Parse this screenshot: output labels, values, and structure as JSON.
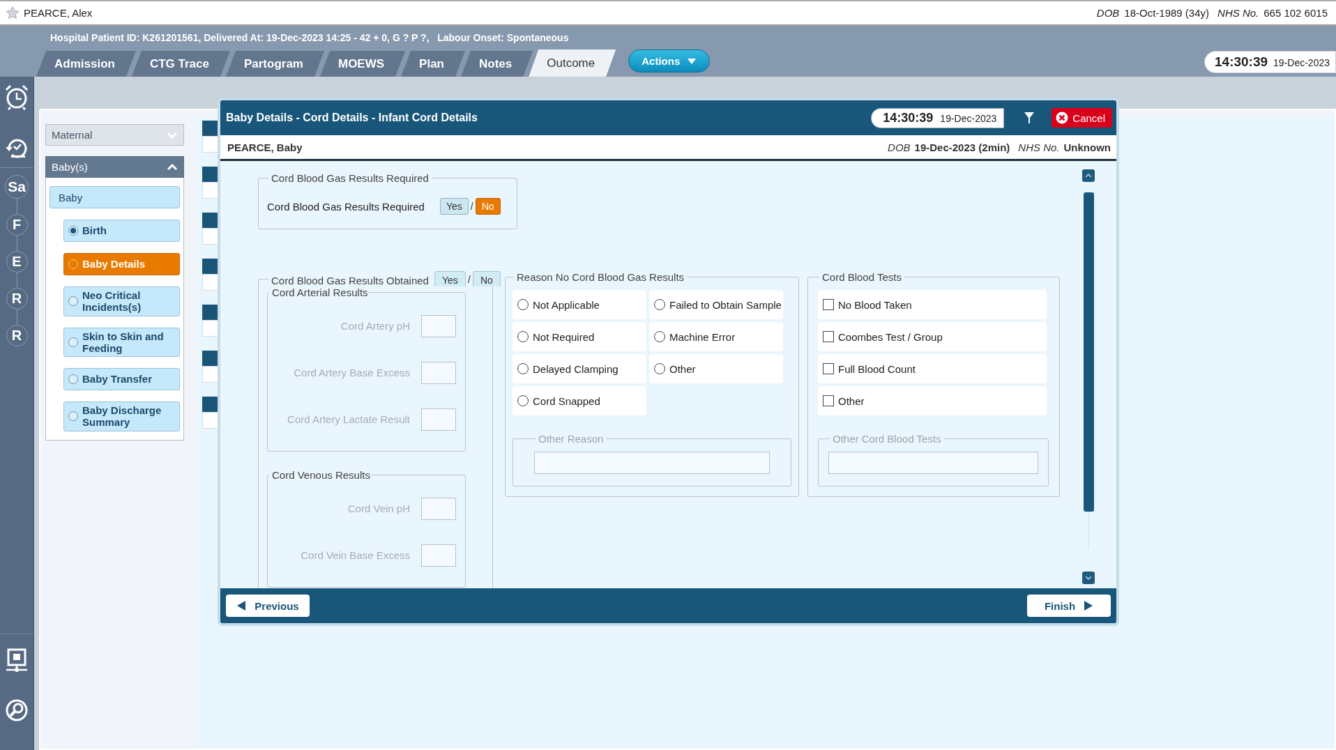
{
  "patient_bar": {
    "name": "PEARCE, Alex",
    "dob_label": "DOB",
    "dob": "18-Oct-1989 (34y)",
    "nhs_label": "NHS No.",
    "nhs": "665 102 6015"
  },
  "header": {
    "info": "Hospital Patient ID: K261201561, Delivered At: 19-Dec-2023 14:25 - 42 + 0, G ? P ?,   Labour Onset: Spontaneous",
    "tabs": [
      {
        "label": "Admission",
        "selected": false
      },
      {
        "label": "CTG Trace",
        "selected": false
      },
      {
        "label": "Partogram",
        "selected": false
      },
      {
        "label": "MOEWS",
        "selected": false
      },
      {
        "label": "Plan",
        "selected": false
      },
      {
        "label": "Notes",
        "selected": false
      },
      {
        "label": "Outcome",
        "selected": true
      }
    ],
    "actions": "Actions",
    "clock": {
      "time": "14:30:39",
      "date": "19-Dec-2023"
    }
  },
  "rail": {
    "letters": [
      "Sa",
      "F",
      "E",
      "R",
      "R"
    ]
  },
  "nav": {
    "maternal": {
      "label": "Maternal",
      "expanded": false
    },
    "babies": {
      "label": "Baby(s)",
      "expanded": true
    },
    "baby": "Baby",
    "items": [
      {
        "label": "Birth",
        "checked": true,
        "selected": false
      },
      {
        "label": "Baby Details",
        "checked": false,
        "selected": true
      },
      {
        "label": "Neo Critical Incidents(s)",
        "checked": false,
        "selected": false
      },
      {
        "label": "Skin to Skin and Feeding",
        "checked": false,
        "selected": false
      },
      {
        "label": "Baby Transfer",
        "checked": false,
        "selected": false
      },
      {
        "label": "Baby Discharge Summary",
        "checked": false,
        "selected": false
      }
    ]
  },
  "dialog": {
    "title": "Baby Details - Cord Details - Infant Cord Details",
    "clock": {
      "time": "14:30:39",
      "date": "19-Dec-2023"
    },
    "cancel": "Cancel",
    "patient": {
      "name": "PEARCE, Baby",
      "dob_label": "DOB",
      "dob": "19-Dec-2023 (2min)",
      "nhs_label": "NHS No.",
      "nhs": "Unknown"
    },
    "required": {
      "legend": "Cord Blood Gas Results Required",
      "label": "Cord Blood Gas Results Required",
      "separator": "/",
      "options": [
        {
          "label": "Yes",
          "selected": false
        },
        {
          "label": "No",
          "selected": true
        }
      ]
    },
    "obtained": {
      "legend": "Cord Blood Gas Results Obtained",
      "separator": "/",
      "options": [
        {
          "label": "Yes",
          "selected": false
        },
        {
          "label": "No",
          "selected": false
        }
      ],
      "groups": [
        {
          "legend": "Cord Arterial Results",
          "fields": [
            {
              "label": "Cord Artery pH",
              "disabled": true
            },
            {
              "label": "Cord Artery Base Excess",
              "disabled": true
            },
            {
              "label": "Cord Artery Lactate Result",
              "disabled": true
            }
          ]
        },
        {
          "legend": "Cord Venous Results",
          "fields": [
            {
              "label": "Cord Vein pH",
              "disabled": true
            },
            {
              "label": "Cord Vein Base Excess",
              "disabled": true
            }
          ]
        }
      ]
    },
    "reason": {
      "legend": "Reason No Cord Blood Gas Results",
      "options": [
        {
          "label": "Not Applicable",
          "checked": false
        },
        {
          "label": "Failed to Obtain Sample",
          "checked": false
        },
        {
          "label": "Not Required",
          "checked": false
        },
        {
          "label": "Machine Error",
          "checked": false
        },
        {
          "label": "Delayed Clamping",
          "checked": false
        },
        {
          "label": "Other",
          "checked": false
        },
        {
          "label": "Cord Snapped",
          "checked": false
        }
      ],
      "other": {
        "legend": "Other Reason",
        "disabled": true
      }
    },
    "tests": {
      "legend": "Cord Blood Tests",
      "options": [
        {
          "label": "No Blood Taken",
          "checked": false
        },
        {
          "label": "Coombes Test / Group",
          "checked": false
        },
        {
          "label": "Full Blood Count",
          "checked": false
        },
        {
          "label": "Other",
          "checked": false
        }
      ],
      "other": {
        "legend": "Other Cord Blood Tests",
        "disabled": true
      }
    },
    "previous": "Previous",
    "finish": "Finish"
  }
}
